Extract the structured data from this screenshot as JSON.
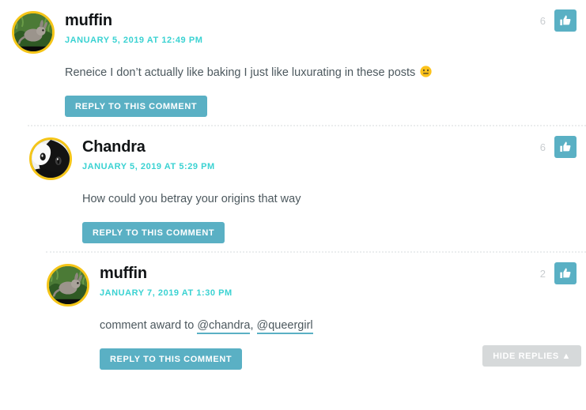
{
  "theme": {
    "accent_teal": "#5ab0c4",
    "timestamp_cyan": "#3ad2d2",
    "avatar_ring": "#f5c518",
    "body_text": "#4c585e",
    "username_text": "#111416",
    "count_text": "#c9cdd0",
    "divider": "#ebedee",
    "hide_button_bg": "#d6d9da"
  },
  "comments": [
    {
      "id": "comment-1",
      "depth": 0,
      "username": "muffin",
      "timestamp": "January 5, 2019 at 12:49 pm",
      "avatar_icon": "rabbit-avatar",
      "body_prefix": "Reneice I don’t actually like baking I just like luxurating in these posts ",
      "body_emoji": "slightly-smiling-face",
      "vote_count": "6",
      "vote_icon": "thumbs-up-icon",
      "reply_label": "Reply to this comment",
      "mentions": [],
      "show_divider_above": false,
      "hide_replies_label": null
    },
    {
      "id": "comment-2",
      "depth": 1,
      "username": "Chandra",
      "timestamp": "January 5, 2019 at 5:29 pm",
      "avatar_icon": "tuxedo-cat-avatar",
      "body_prefix": "How could you betray your origins that way",
      "body_emoji": null,
      "vote_count": "6",
      "vote_icon": "thumbs-up-icon",
      "reply_label": "Reply to this comment",
      "mentions": [],
      "show_divider_above": true,
      "hide_replies_label": null
    },
    {
      "id": "comment-3",
      "depth": 2,
      "username": "muffin",
      "timestamp": "January 7, 2019 at 1:30 pm",
      "avatar_icon": "rabbit-avatar",
      "body_prefix": "comment award to ",
      "body_emoji": null,
      "vote_count": "2",
      "vote_icon": "thumbs-up-icon",
      "reply_label": "Reply to this comment",
      "mentions": [
        "@chandra",
        "@queergirl"
      ],
      "mention_separator": ", ",
      "show_divider_above": true,
      "hide_replies_label": "Hide replies ▲"
    }
  ]
}
